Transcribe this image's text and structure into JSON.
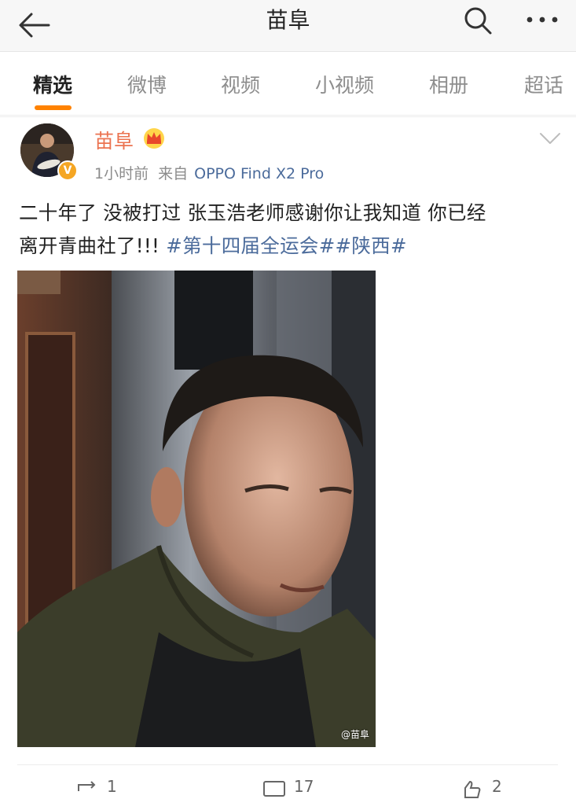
{
  "header": {
    "title": "苗阜",
    "back_icon": "arrow-left-icon",
    "search_icon": "search-icon",
    "more_icon": "more-dots-icon"
  },
  "tabs": [
    {
      "label": "精选",
      "active": true
    },
    {
      "label": "微博",
      "active": false
    },
    {
      "label": "视频",
      "active": false
    },
    {
      "label": "小视频",
      "active": false
    },
    {
      "label": "相册",
      "active": false
    },
    {
      "label": "超话",
      "active": false
    }
  ],
  "post": {
    "author": "苗阜",
    "verified_badge": "V",
    "time": "1小时前",
    "source_prefix": "来自",
    "device": "OPPO Find X2 Pro",
    "text_line1": "二十年了 没被打过 张玉浩老师感谢你让我知道 你已经",
    "text_line2_plain": "离开青曲社了!!! ",
    "hashtag1": "#第十四届全运会#",
    "hashtag2": "#陕西#",
    "image_watermark": "@苗阜",
    "actions": [
      {
        "name": "repost",
        "count": "1"
      },
      {
        "name": "comment",
        "count": "17"
      },
      {
        "name": "like",
        "count": "2"
      }
    ]
  },
  "colors": {
    "accent": "#ff8200",
    "username": "#eb7350",
    "link": "#4b6b9b",
    "verified": "#f5a623"
  }
}
